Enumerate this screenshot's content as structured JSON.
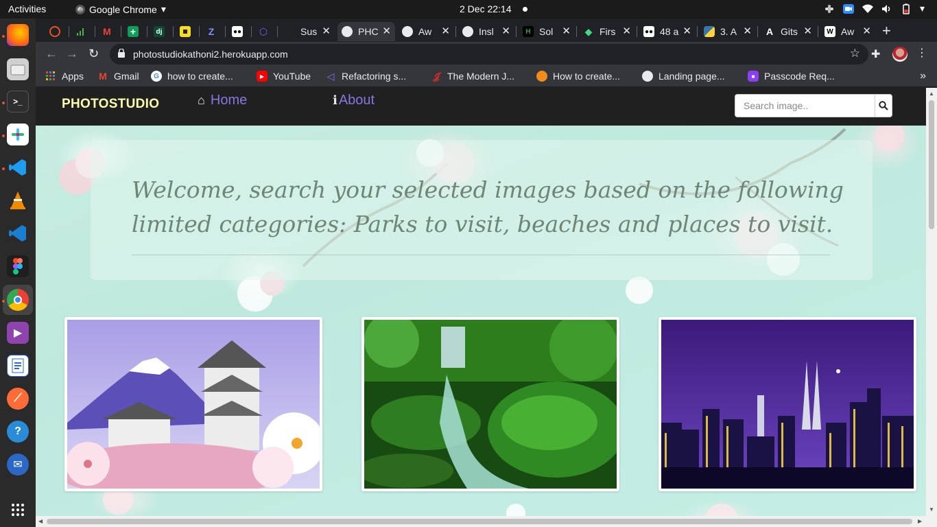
{
  "topbar": {
    "activities": "Activities",
    "app_name": "Google Chrome",
    "clock": "2 Dec  22:14"
  },
  "dock": {
    "items": [
      "firefox",
      "files",
      "terminal",
      "slack",
      "vscode",
      "vlc",
      "vscode-alt",
      "figma",
      "chrome",
      "video",
      "text-editor",
      "postman",
      "help",
      "thunderbird",
      "show-apps"
    ]
  },
  "browser": {
    "tabs": [
      {
        "label": "",
        "icon": "ubuntu-icon",
        "color": "#e95420"
      },
      {
        "label": "",
        "icon": "bars-icon",
        "color": "#4caf50"
      },
      {
        "label": "",
        "icon": "gmail-icon",
        "color": "#ea4335"
      },
      {
        "label": "",
        "icon": "plus-square-icon",
        "color": "#0f9d58"
      },
      {
        "label": "",
        "icon": "django-icon",
        "color": "#0c4b33"
      },
      {
        "label": "",
        "icon": "yellow-square-icon",
        "color": "#f7df1e"
      },
      {
        "label": "",
        "icon": "zed-icon",
        "color": "#5a4fcf"
      },
      {
        "label": "",
        "icon": "medium-icon",
        "color": "#000000"
      },
      {
        "label": "",
        "icon": "hex-icon",
        "color": "#6c63ff"
      },
      {
        "label": "Sus",
        "icon": "github-icon",
        "color": "#222222"
      },
      {
        "label": "PHC",
        "icon": "globe-icon",
        "color": "#e8eaed"
      },
      {
        "label": "Aw",
        "icon": "globe-icon",
        "color": "#e8eaed"
      },
      {
        "label": "Insl",
        "icon": "globe-icon",
        "color": "#e8eaed"
      },
      {
        "label": "Sol",
        "icon": "hackerrank-icon",
        "color": "#1ba94c"
      },
      {
        "label": "Firs",
        "icon": "diamond-icon",
        "color": "#3ddc84"
      },
      {
        "label": "48 a",
        "icon": "medium-icon",
        "color": "#000000"
      },
      {
        "label": "3. A",
        "icon": "python-icon",
        "color": "#ffd43b"
      },
      {
        "label": "Gits",
        "icon": "a-icon",
        "color": "#000000"
      },
      {
        "label": "Aw",
        "icon": "w-icon",
        "color": "#000000"
      }
    ],
    "url": "photostudiokathoni2.herokuapp.com",
    "bookmarks": [
      {
        "label": "Apps",
        "icon": "apps-grid-icon",
        "color": "#4285f4"
      },
      {
        "label": "Gmail",
        "icon": "gmail-icon",
        "color": "#ea4335"
      },
      {
        "label": "how to create...",
        "icon": "google-icon",
        "color": "#4285f4"
      },
      {
        "label": "YouTube",
        "icon": "youtube-icon",
        "color": "#ff0000"
      },
      {
        "label": "Refactoring s...",
        "icon": "vs-icon",
        "color": "#6c4ad6"
      },
      {
        "label": "The Modern J...",
        "icon": "jx-icon",
        "color": "#d12d2d"
      },
      {
        "label": "How to create...",
        "icon": "orange-icon",
        "color": "#f28c1a"
      },
      {
        "label": "Landing page...",
        "icon": "globe-icon",
        "color": "#e8eaed"
      },
      {
        "label": "Passcode Req...",
        "icon": "video-icon",
        "color": "#8c3ff5"
      }
    ]
  },
  "site": {
    "brand": "PHOTOSTUDIO",
    "nav": {
      "home": "Home",
      "about": "About"
    },
    "search": {
      "placeholder": "Search image.."
    },
    "welcome": "Welcome, search your selected images based on the following limited categories: Parks to visit, beaches and places to visit.",
    "colors": {
      "brand": "#ffffb0",
      "nav_link": "#8a76e0",
      "navbar_bg": "#202020"
    }
  }
}
